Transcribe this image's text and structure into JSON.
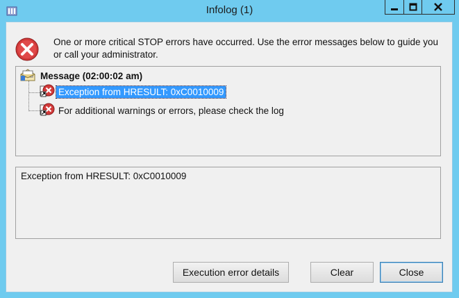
{
  "window": {
    "title": "Infolog (1)",
    "icons": {
      "app": "infolog-app-icon",
      "minimize": "minimize-icon",
      "maximize": "maximize-icon",
      "close": "close-icon"
    }
  },
  "header": {
    "message": "One or more critical STOP errors have occurred. Use the error messages below to guide you or call your administrator.",
    "icon": "critical-error-icon"
  },
  "tree": {
    "root_label": "Message (02:00:02 am)",
    "root_icon": "open-envelope-icon",
    "items": [
      {
        "label": "Exception from HRESULT: 0xC0010009",
        "icon": "error-icon",
        "selected": true
      },
      {
        "label": "For additional warnings or errors, please check the log",
        "icon": "error-icon",
        "selected": false
      }
    ]
  },
  "detail": {
    "text": "Exception from HRESULT: 0xC0010009"
  },
  "buttons": {
    "execution_details": "Execution error details",
    "clear": "Clear",
    "close": "Close"
  },
  "colors": {
    "titlebar": "#6fcbef",
    "selection": "#3399ff",
    "error_red": "#d32f2f"
  }
}
